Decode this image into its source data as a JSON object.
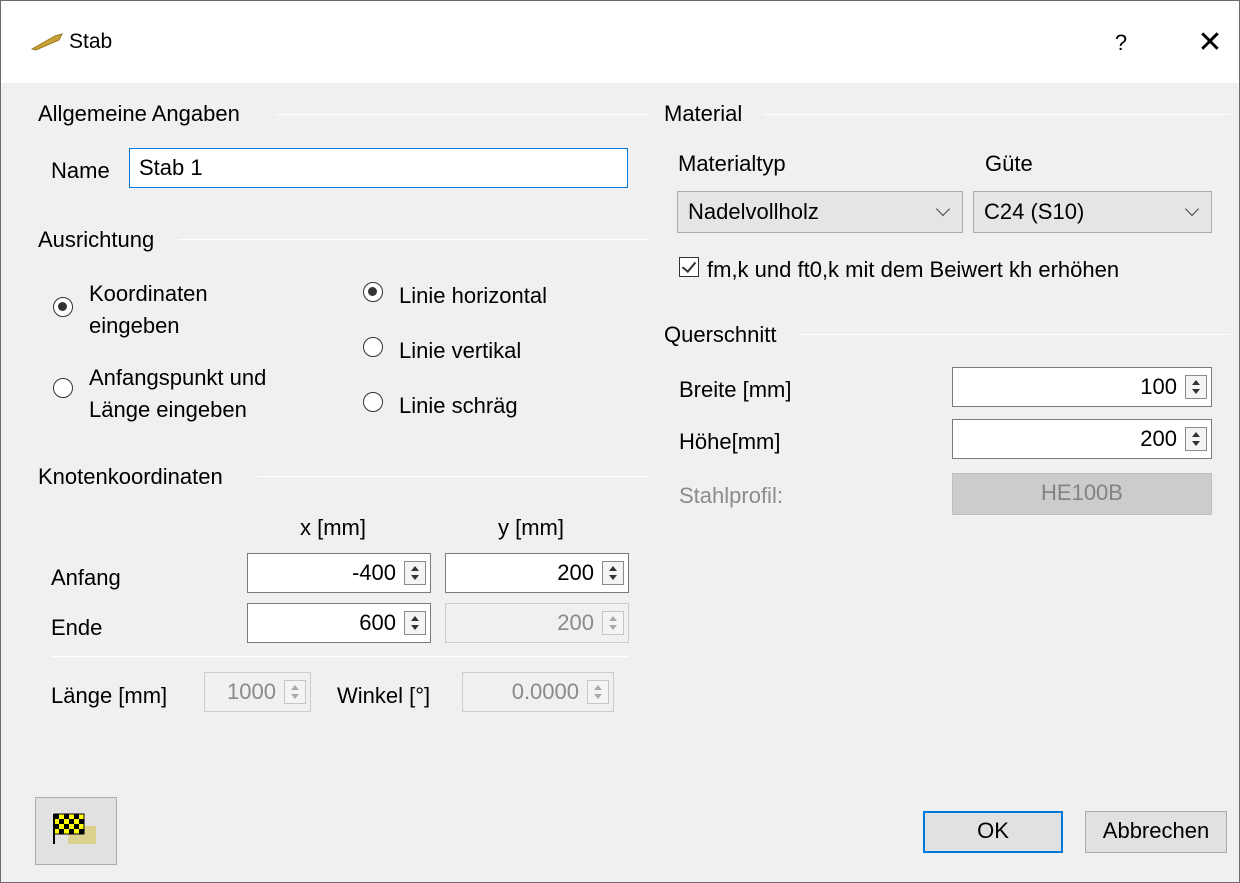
{
  "window": {
    "title": "Stab",
    "help_label": "?",
    "close_label": "✕"
  },
  "general": {
    "legend": "Allgemeine Angaben",
    "name_label": "Name",
    "name_value": "Stab 1"
  },
  "orientation": {
    "legend": "Ausrichtung",
    "options_left": [
      {
        "line1": "Koordinaten",
        "line2": "eingeben",
        "selected": true
      },
      {
        "line1": "Anfangspunkt und",
        "line2": "Länge eingeben",
        "selected": false
      }
    ],
    "options_right": [
      {
        "label": "Linie horizontal",
        "selected": true
      },
      {
        "label": "Linie vertikal",
        "selected": false
      },
      {
        "label": "Linie schräg",
        "selected": false
      }
    ]
  },
  "nodes": {
    "legend": "Knotenkoordinaten",
    "col_x": "x [mm]",
    "col_y": "y [mm]",
    "rows": [
      {
        "label": "Anfang",
        "x": "-400",
        "y": "200"
      },
      {
        "label": "Ende",
        "x": "600",
        "y": "200"
      }
    ],
    "length_label": "Länge [mm]",
    "length_value": "1000",
    "angle_label": "Winkel [°]",
    "angle_value": "0.0000"
  },
  "material": {
    "legend": "Material",
    "type_label": "Materialtyp",
    "type_value": "Nadelvollholz",
    "grade_label": "Güte",
    "grade_value": "C24 (S10)",
    "kh_checkbox_label": "fm,k und ft0,k mit dem Beiwert kh erhöhen",
    "kh_checked": true
  },
  "section": {
    "legend": "Querschnitt",
    "width_label": "Breite [mm]",
    "width_value": "100",
    "height_label": "Höhe[mm]",
    "height_value": "200",
    "steel_label": "Stahlprofil:",
    "steel_value": "HE100B"
  },
  "buttons": {
    "ok": "OK",
    "cancel": "Abbrechen"
  },
  "colors": {
    "focus": "#0078d7",
    "window_bg": "#f0f0f0"
  }
}
